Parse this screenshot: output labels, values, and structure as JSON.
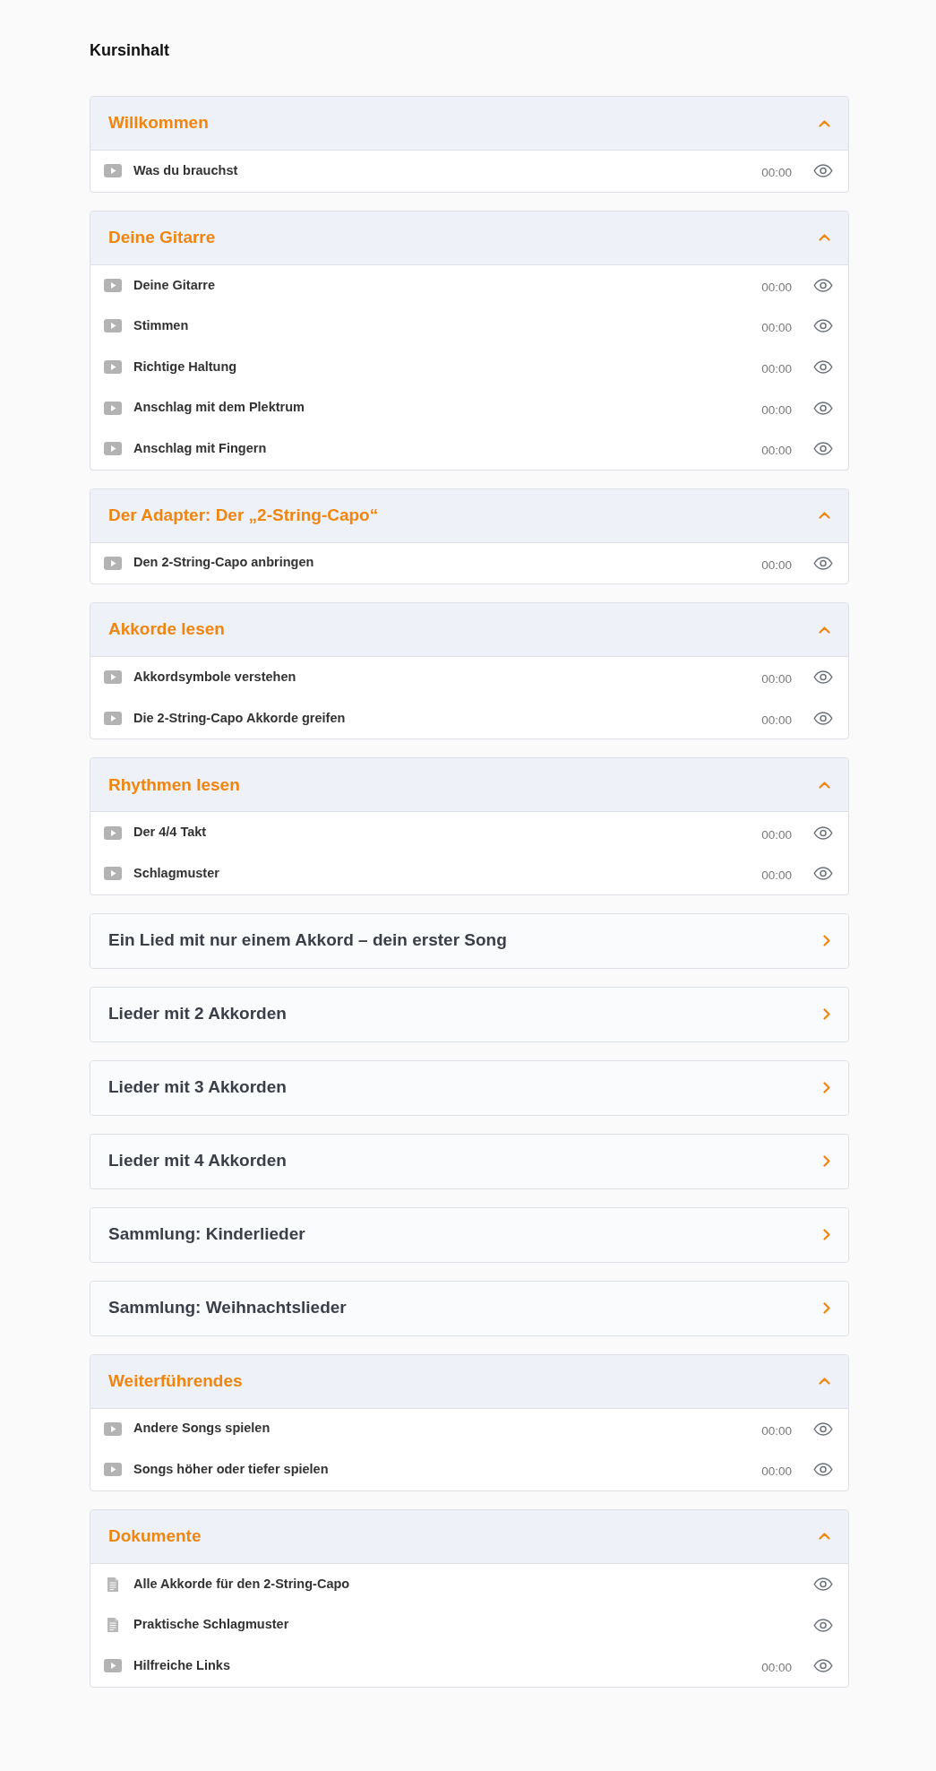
{
  "title": "Kursinhalt",
  "sections": [
    {
      "title": "Willkommen",
      "expanded": true,
      "lessons": [
        {
          "kind": "video",
          "title": "Was du brauchst",
          "duration": "00:00"
        }
      ]
    },
    {
      "title": "Deine Gitarre",
      "expanded": true,
      "lessons": [
        {
          "kind": "video",
          "title": "Deine Gitarre",
          "duration": "00:00"
        },
        {
          "kind": "video",
          "title": "Stimmen",
          "duration": "00:00"
        },
        {
          "kind": "video",
          "title": "Richtige Haltung",
          "duration": "00:00"
        },
        {
          "kind": "video",
          "title": "Anschlag mit dem Plektrum",
          "duration": "00:00"
        },
        {
          "kind": "video",
          "title": "Anschlag mit Fingern",
          "duration": "00:00"
        }
      ]
    },
    {
      "title": "Der Adapter: Der „2-String-Capo“",
      "expanded": true,
      "lessons": [
        {
          "kind": "video",
          "title": "Den 2-String-Capo anbringen",
          "duration": "00:00"
        }
      ]
    },
    {
      "title": "Akkorde lesen",
      "expanded": true,
      "lessons": [
        {
          "kind": "video",
          "title": "Akkordsymbole verstehen",
          "duration": "00:00"
        },
        {
          "kind": "video",
          "title": "Die 2-String-Capo Akkorde greifen",
          "duration": "00:00"
        }
      ]
    },
    {
      "title": "Rhythmen lesen",
      "expanded": true,
      "lessons": [
        {
          "kind": "video",
          "title": "Der 4/4 Takt",
          "duration": "00:00"
        },
        {
          "kind": "video",
          "title": "Schlagmuster",
          "duration": "00:00"
        }
      ]
    },
    {
      "title": "Ein Lied mit nur einem Akkord – dein erster Song",
      "expanded": false
    },
    {
      "title": "Lieder mit 2 Akkorden",
      "expanded": false
    },
    {
      "title": "Lieder mit 3 Akkorden",
      "expanded": false
    },
    {
      "title": "Lieder mit 4 Akkorden",
      "expanded": false
    },
    {
      "title": "Sammlung: Kinderlieder",
      "expanded": false
    },
    {
      "title": "Sammlung: Weihnachtslieder",
      "expanded": false
    },
    {
      "title": "Weiterführendes",
      "expanded": true,
      "lessons": [
        {
          "kind": "video",
          "title": "Andere Songs spielen",
          "duration": "00:00"
        },
        {
          "kind": "video",
          "title": "Songs höher oder tiefer spielen",
          "duration": "00:00"
        }
      ]
    },
    {
      "title": "Dokumente",
      "expanded": true,
      "lessons": [
        {
          "kind": "document",
          "title": "Alle Akkorde für den 2-String-Capo"
        },
        {
          "kind": "document",
          "title": "Praktische Schlagmuster"
        },
        {
          "kind": "video",
          "title": "Hilfreiche Links",
          "duration": "00:00"
        }
      ]
    }
  ]
}
